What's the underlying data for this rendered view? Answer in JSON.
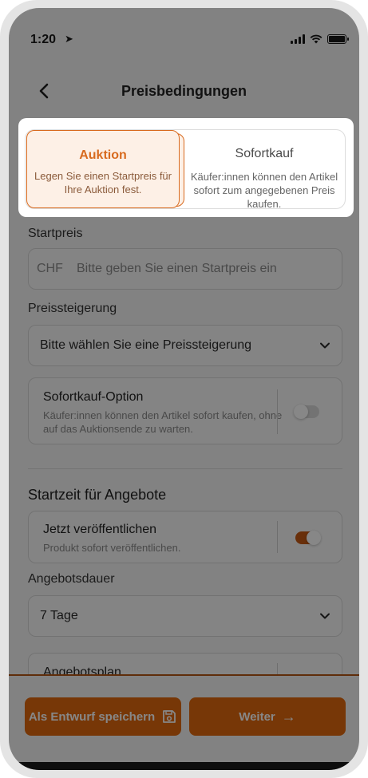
{
  "status_bar": {
    "time": "1:20",
    "location_glyph": "➤"
  },
  "header": {
    "title": "Preisbedingungen",
    "back_icon": "chevron-left-icon"
  },
  "price_type": {
    "auction": {
      "title": "Auktion",
      "description": "Legen Sie einen Startpreis für Ihre Auktion fest.",
      "selected": true
    },
    "instant": {
      "title": "Sofortkauf",
      "description": "Käufer:innen können den Artikel sofort zum angegebenen Preis kaufen.",
      "selected": false
    }
  },
  "start_price": {
    "label": "Startpreis",
    "currency": "CHF",
    "placeholder": "Bitte geben Sie einen Startpreis ein"
  },
  "increment": {
    "label": "Preissteigerung",
    "value": "Bitte wählen Sie eine Preissteigerung"
  },
  "buy_now_option": {
    "title": "Sofortkauf-Option",
    "description": "Käufer:innen können den Artikel sofort kaufen, ohne auf das Auktionsende zu warten.",
    "enabled": false
  },
  "start_time_section": {
    "heading": "Startzeit für Angebote"
  },
  "publish_now": {
    "title": "Jetzt veröffentlichen",
    "description": "Produkt sofort veröffentlichen.",
    "enabled": true
  },
  "duration": {
    "label": "Angebotsdauer",
    "value": "7 Tage"
  },
  "schedule": {
    "title": "Angebotsplan"
  },
  "footer": {
    "draft_label": "Als Entwurf speichern",
    "next_label": "Weiter",
    "next_arrow": "→"
  },
  "colors": {
    "accent": "#e0690f",
    "accent_light": "#fdf0e6",
    "switch_on": "#c65a14"
  }
}
